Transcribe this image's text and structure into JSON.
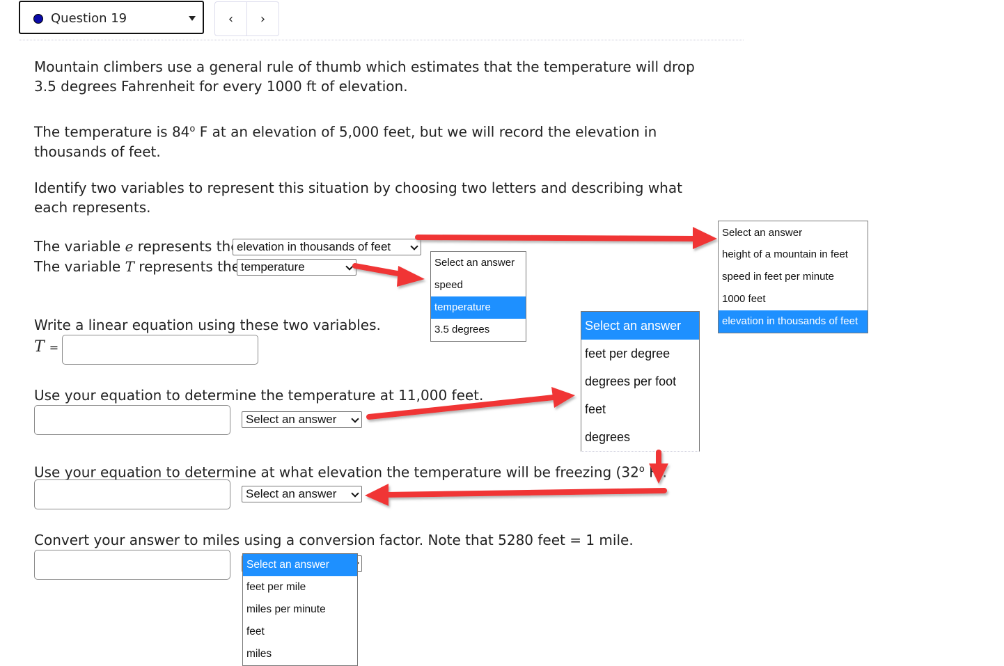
{
  "header": {
    "question_label": "Question 19",
    "status_color": "#0a0aa8",
    "prev_icon": "chevron-left-icon",
    "next_icon": "chevron-right-icon",
    "prev_glyph": "‹",
    "next_glyph": "›"
  },
  "question": {
    "p1": "Mountain climbers use a general rule of thumb which estimates that the temperature will drop 3.5 degrees Fahrenheit for every 1000 ft of elevation.",
    "p2_before": "The temperature is 84",
    "p2_sup": "o",
    "p2_after": " F at an elevation of 5,000 feet, but we will record the elevation in thousands of feet.",
    "p3": "Identify two variables to represent this situation by choosing two letters and describing what each represents.",
    "var_e": {
      "prefix": "The variable ",
      "letter": "e",
      "suffix": " represents the",
      "selected": "elevation in thousands of feet"
    },
    "var_T": {
      "prefix": "The variable ",
      "letter": "T",
      "suffix": " represents the",
      "selected": "temperature"
    },
    "equation_prompt": "Write a linear equation using these two variables.",
    "equation_lhs": "T",
    "equation_eq": "=",
    "equation_value": "",
    "part_temp_prompt": "Use your equation to determine the temperature at 11,000 feet.",
    "part_temp_value": "",
    "part_temp_unit": "Select an answer",
    "part_freeze_before": "Use your equation to determine at what elevation the temperature will be freezing (32",
    "part_freeze_sup": "o",
    "part_freeze_after": " F).",
    "part_freeze_value": "",
    "part_freeze_unit": "Select an answer",
    "part_miles_prompt": "Convert your answer to miles using a conversion factor. Note that 5280 feet = 1 mile.",
    "part_miles_value": "",
    "part_miles_unit": "Select an answer"
  },
  "dropdowns": {
    "var_T_options": {
      "highlighted": "temperature",
      "items": [
        "Select an answer",
        "speed",
        "temperature",
        "3.5 degrees"
      ]
    },
    "var_e_options": {
      "highlighted": "elevation in thousands of feet",
      "items": [
        "Select an answer",
        "height of a mountain in feet",
        "speed in feet per minute",
        "1000 feet",
        "elevation in thousands of feet"
      ]
    },
    "unit_options": {
      "highlighted": "Select an answer",
      "items": [
        "Select an answer",
        "feet per degree",
        "degrees per foot",
        "feet",
        "degrees"
      ]
    },
    "miles_options": {
      "highlighted": "Select an answer",
      "items": [
        "Select an answer",
        "feet per mile",
        "miles per minute",
        "feet",
        "miles"
      ]
    }
  },
  "colors": {
    "highlight": "#1e90ff",
    "annotation_arrow": "#f03434"
  }
}
